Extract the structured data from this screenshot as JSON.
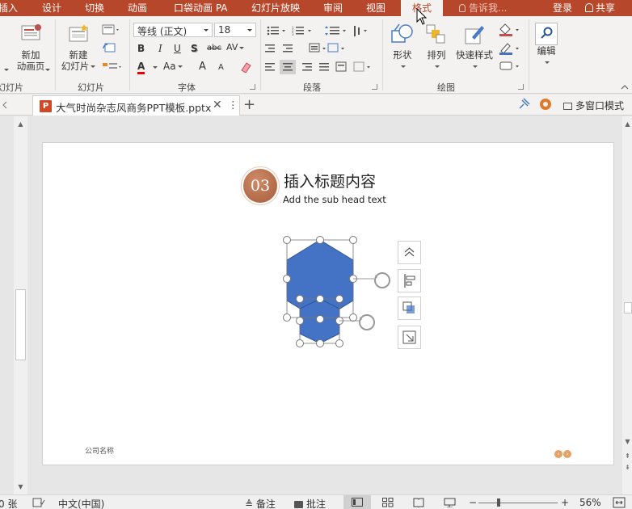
{
  "menu": {
    "tabs": [
      "插入",
      "设计",
      "切换",
      "动画",
      "口袋动画 PA",
      "幻灯片放映",
      "审阅",
      "视图"
    ],
    "active_tab": "格式",
    "tell_me": "告诉我...",
    "login": "登录",
    "share": "共享"
  },
  "ribbon": {
    "slides_group": {
      "partial_label": "幻灯片",
      "new_anim_page": "新加\n动画页",
      "new_slide_line1": "新建",
      "new_slide_line2": "幻灯片",
      "group_label": "幻灯片"
    },
    "font_group": {
      "font_name": "等线 (正文)",
      "font_size": "18",
      "bold": "B",
      "italic": "I",
      "underline": "U",
      "shadow": "S",
      "strike": "abc",
      "spacing": "AV",
      "color_a": "A",
      "case": "Aa",
      "grow": "A",
      "shrink": "A",
      "group_label": "字体"
    },
    "paragraph_group": {
      "group_label": "段落"
    },
    "drawing_group": {
      "shapes": "形状",
      "arrange": "排列",
      "quick_styles": "快速样式",
      "group_label": "绘图"
    },
    "editing_group": {
      "edit": "编辑"
    }
  },
  "document_tab": {
    "file_name": "大气时尚杂志风商务PPT模板.pptx",
    "icon_letter": "P",
    "multi_window": "多窗口模式"
  },
  "slide": {
    "badge_number": "03",
    "title": "插入标题内容",
    "subtitle": "Add the sub head text",
    "company": "公司名称",
    "nav_prev": "‹",
    "nav_next": "›"
  },
  "shape_colors": {
    "hex_fill": "#4472c4",
    "hex_stroke": "#2f5597"
  },
  "statusbar": {
    "slide_count": "0 张",
    "language": "中文(中国)",
    "notes": "备注",
    "comments": "批注",
    "zoom": "56%"
  },
  "icons": {
    "layout_options": "chevron-up-icon",
    "align": "align-icon",
    "crop": "crop-icon",
    "format_pane": "expand-icon"
  }
}
